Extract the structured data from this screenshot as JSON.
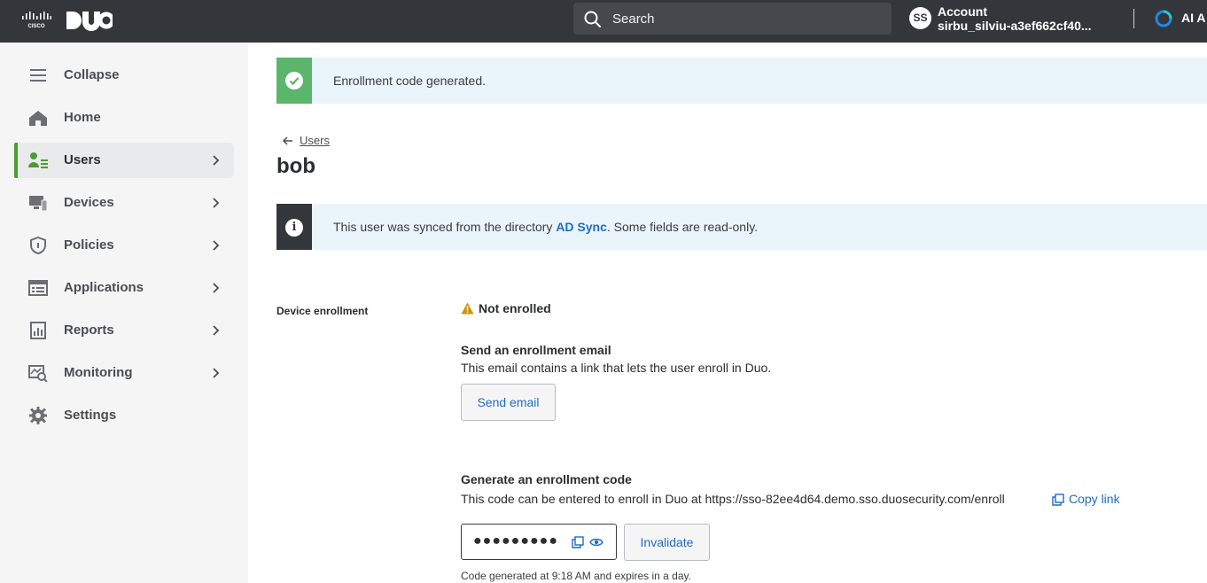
{
  "header": {
    "search_placeholder": "Search",
    "account_initials": "SS",
    "account_title": "Account",
    "account_name": "sirbu_silviu-a3ef662cf40...",
    "ai_label": "AI A"
  },
  "sidebar": {
    "items": [
      {
        "label": "Collapse",
        "icon": "menu-icon",
        "chevron": false,
        "active": false
      },
      {
        "label": "Home",
        "icon": "home-icon",
        "chevron": false,
        "active": false
      },
      {
        "label": "Users",
        "icon": "users-icon",
        "chevron": true,
        "active": true
      },
      {
        "label": "Devices",
        "icon": "devices-icon",
        "chevron": true,
        "active": false
      },
      {
        "label": "Policies",
        "icon": "shield-icon",
        "chevron": true,
        "active": false
      },
      {
        "label": "Applications",
        "icon": "applications-icon",
        "chevron": true,
        "active": false
      },
      {
        "label": "Reports",
        "icon": "reports-icon",
        "chevron": true,
        "active": false
      },
      {
        "label": "Monitoring",
        "icon": "monitoring-icon",
        "chevron": true,
        "active": false
      },
      {
        "label": "Settings",
        "icon": "gear-icon",
        "chevron": false,
        "active": false
      }
    ]
  },
  "main": {
    "success_banner": "Enrollment code generated.",
    "breadcrumb": "Users",
    "title": "bob",
    "info_banner": {
      "prefix": "This user was synced from the directory ",
      "link": "AD Sync",
      "suffix": ". Some fields are read-only."
    },
    "device_enrollment": {
      "label": "Device enrollment",
      "status": "Not enrolled",
      "email": {
        "heading": "Send an enrollment email",
        "description": "This email contains a link that lets the user enroll in Duo.",
        "button": "Send email"
      },
      "code": {
        "heading": "Generate an enrollment code",
        "description": "This code can be entered to enroll in Duo at https://sso-82ee4d64.demo.sso.duosecurity.com/enroll",
        "copy_link": "Copy link",
        "masked_value": "●●●●●●●●●",
        "invalidate_button": "Invalidate",
        "expiry_note": "Code generated at 9:18 AM and expires in a day."
      }
    }
  },
  "colors": {
    "topbar": "#33373b",
    "accent_green": "#4e9b35",
    "link_blue": "#1f6cc7",
    "banner_bg": "#eaf4fb",
    "warning": "#d4900a"
  }
}
